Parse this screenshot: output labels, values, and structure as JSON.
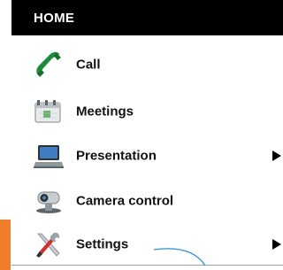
{
  "header": {
    "title": "HOME"
  },
  "menu": {
    "items": [
      {
        "label": "Call",
        "icon": "phone-icon",
        "has_submenu": false
      },
      {
        "label": "Meetings",
        "icon": "calendar-icon",
        "has_submenu": false
      },
      {
        "label": "Presentation",
        "icon": "laptop-icon",
        "has_submenu": true
      },
      {
        "label": "Camera control",
        "icon": "webcam-icon",
        "has_submenu": false
      },
      {
        "label": "Settings",
        "icon": "tools-icon",
        "has_submenu": true
      }
    ]
  },
  "colors": {
    "header_bg": "#000000",
    "accent": "#ef7d2b",
    "pointer": "#2b8fcf"
  }
}
